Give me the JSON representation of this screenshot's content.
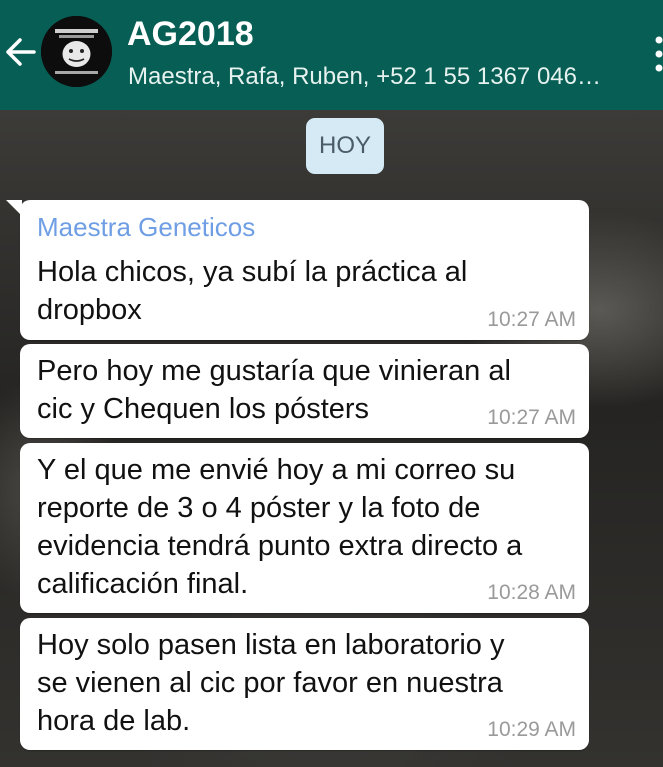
{
  "header": {
    "title": "AG2018",
    "subtitle": "Maestra, Rafa, Ruben, +52 1 55 1367 046…"
  },
  "date_chip": "HOY",
  "messages": [
    {
      "sender": "Maestra Geneticos",
      "lines": [
        "Hola chicos, ya subí la práctica al",
        "dropbox"
      ],
      "time": "10:27 AM"
    },
    {
      "lines": [
        "Pero hoy me gustaría que vinieran al",
        "cic y Chequen los pósters"
      ],
      "time": "10:27 AM"
    },
    {
      "lines": [
        "Y el que me envié hoy a mi correo su",
        "reporte de 3 o 4 póster y la foto de",
        "evidencia tendrá punto extra directo a",
        "calificación final."
      ],
      "time": "10:28 AM"
    },
    {
      "lines": [
        "Hoy solo pasen lista en laboratorio y",
        "se vienen al cic por favor en nuestra",
        "hora de lab."
      ],
      "time": "10:29 AM"
    }
  ]
}
